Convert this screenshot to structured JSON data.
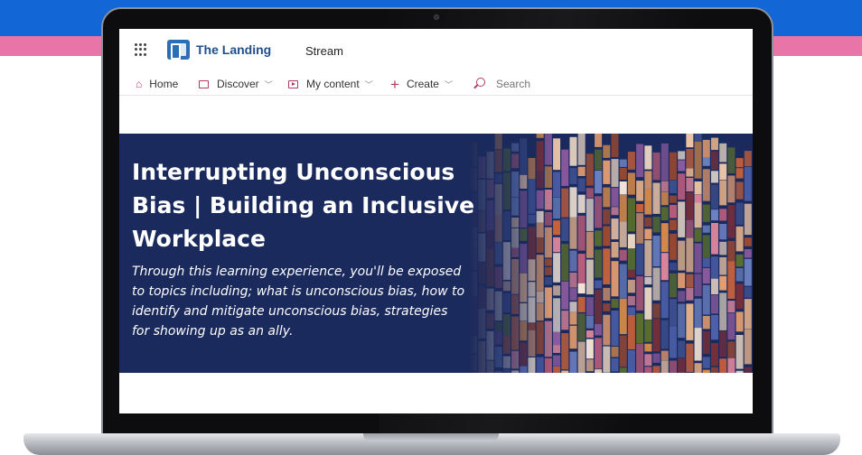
{
  "colors": {
    "band_blue": "#1366d6",
    "band_pink": "#e874a8",
    "hero_bg": "#1b2a5c",
    "nav_icon": "#b33b5e",
    "site_title": "#1f4e8c"
  },
  "header": {
    "waffle_icon": "app-launcher-icon",
    "logo_icon": "the-landing-logo",
    "site_title": "The Landing",
    "app_name": "Stream"
  },
  "nav": {
    "items": [
      {
        "label": "Home",
        "icon": "home-icon"
      },
      {
        "label": "Discover",
        "icon": "discover-icon",
        "chevron": "chevron-down-icon"
      },
      {
        "label": "My content",
        "icon": "video-icon",
        "chevron": "chevron-down-icon"
      },
      {
        "label": "Create",
        "icon": "plus-icon",
        "chevron": "chevron-down-icon"
      }
    ],
    "search": {
      "icon": "search-icon",
      "placeholder": "Search"
    }
  },
  "hero": {
    "title": "Interrupting Unconscious Bias | Building an Inclusive Workplace",
    "description": "Through this learning experience, you'll be exposed to topics including; what is unconscious bias, how to identify and mitigate unconscious bias, strategies for showing up as an ally.",
    "image": "colorful-abstract-bars-image"
  }
}
